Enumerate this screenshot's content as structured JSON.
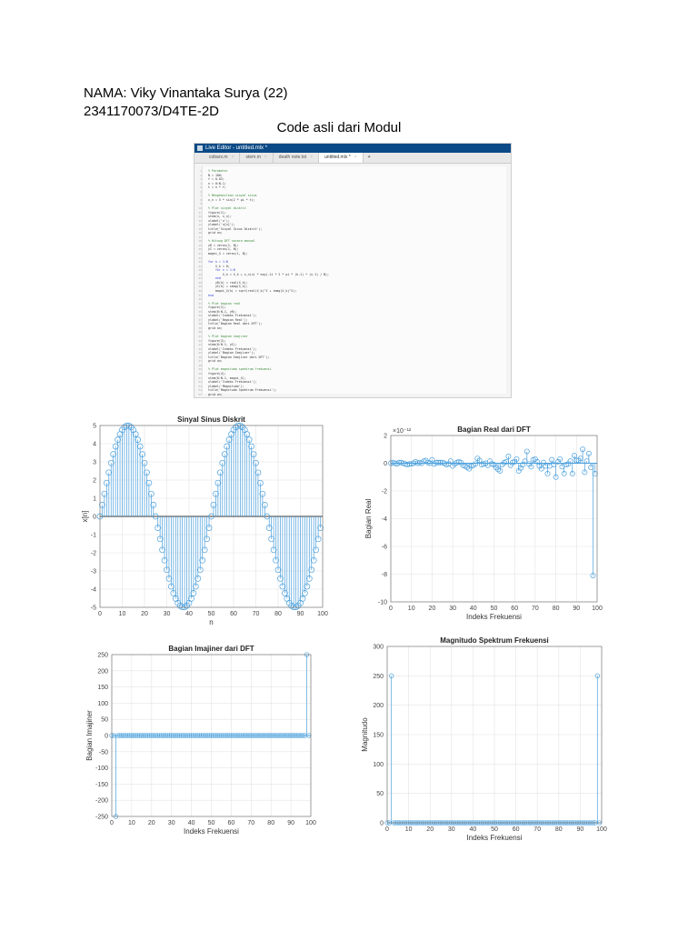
{
  "header": {
    "name_line": "NAMA: Viky Vinantaka Surya (22)",
    "id_line": "2341170073/D4TE-2D",
    "section_title": "Code asli dari Modul"
  },
  "editor": {
    "window_title": "Live Editor - untitled.mlx *",
    "tabs": [
      {
        "label": "cobarx.m",
        "active": false
      },
      {
        "label": "stem.m",
        "active": false
      },
      {
        "label": "death note.txt",
        "active": false
      },
      {
        "label": "untitled.mlx *",
        "active": true
      }
    ],
    "add_tab_label": "+",
    "close_glyph": "×",
    "code_lines": [
      "% Parameter",
      "N = 100;",
      "f = 0.02;",
      "n = 0:N-1;",
      "t = n * f;",
      "",
      "% Menghasilkan sinyal sinus",
      "x_n = 5 * sin(2 * pi * t);",
      "",
      "% Plot sinyal diskrit",
      "figure(1);",
      "stem(n, x_n);",
      "xlabel('n');",
      "ylabel('x[n]');",
      "title('Sinyal Sinus Diskrit');",
      "grid on;",
      "",
      "% Hitung DFT secara manual",
      "yR = zeros(1, N);",
      "yI = zeros(1, N);",
      "magni_X = zeros(1, N);",
      "",
      "for k = 1:N",
      "    X_k = 0;",
      "    for n = 1:N",
      "        X_k = X_k + x_n(n) * exp(-1i * 2 * pi * (k-1) * (n-1) / N);",
      "    end",
      "    yR(k) = real(X_k);",
      "    yI(k) = imag(X_k);",
      "    magni_X(k) = sqrt(real(X_k)^2 + imag(X_k)^2);",
      "end",
      "",
      "% Plot bagian real",
      "figure(2);",
      "stem(0:N-1, yR);",
      "xlabel('Indeks Frekuensi');",
      "ylabel('Bagian Real');",
      "title('Bagian Real dari DFT');",
      "grid on;",
      "",
      "% Plot bagian imajiner",
      "figure(3);",
      "stem(0:N-1, yI);",
      "xlabel('Indeks Frekuensi');",
      "ylabel('Bagian Imajiner');",
      "title('Bagian Imajiner dari DFT');",
      "grid on;",
      "",
      "% Plot magnitudo spektrum frekuensi",
      "figure(4);",
      "stem(0:N-1, magni_X);",
      "xlabel('Indeks Frekuensi');",
      "ylabel('Magnitudo');",
      "title('Magnitudo Spektrum Frekuensi');",
      "grid on;"
    ]
  },
  "colors": {
    "stem": "#4a9fdc",
    "grid": "#e3e3e3",
    "axis": "#666666",
    "baseline": "#333333"
  },
  "chart_data": [
    {
      "type": "stem",
      "title": "Sinyal Sinus Diskrit",
      "xlabel": "n",
      "ylabel": "x[n]",
      "xlim": [
        0,
        100
      ],
      "ylim": [
        -5,
        5
      ],
      "xticks": [
        0,
        10,
        20,
        30,
        40,
        50,
        60,
        70,
        80,
        90,
        100
      ],
      "yticks": [
        -5,
        -4,
        -3,
        -2,
        -1,
        0,
        1,
        2,
        3,
        4,
        5
      ],
      "grid": true,
      "x_start": 0,
      "values": [
        0,
        0.63,
        1.24,
        1.84,
        2.41,
        2.94,
        3.42,
        3.85,
        4.22,
        4.52,
        4.76,
        4.91,
        4.99,
        4.99,
        4.91,
        4.76,
        4.52,
        4.22,
        3.85,
        3.42,
        2.94,
        2.41,
        1.84,
        1.24,
        0.63,
        0,
        -0.63,
        -1.24,
        -1.84,
        -2.41,
        -2.94,
        -3.42,
        -3.85,
        -4.22,
        -4.52,
        -4.76,
        -4.91,
        -4.99,
        -4.99,
        -4.91,
        -4.76,
        -4.52,
        -4.22,
        -3.85,
        -3.42,
        -2.94,
        -2.41,
        -1.84,
        -1.24,
        -0.63,
        0,
        0.63,
        1.24,
        1.84,
        2.41,
        2.94,
        3.42,
        3.85,
        4.22,
        4.52,
        4.76,
        4.91,
        4.99,
        4.99,
        4.91,
        4.76,
        4.52,
        4.22,
        3.85,
        3.42,
        2.94,
        2.41,
        1.84,
        1.24,
        0.63,
        0,
        -0.63,
        -1.24,
        -1.84,
        -2.41,
        -2.94,
        -3.42,
        -3.85,
        -4.22,
        -4.52,
        -4.76,
        -4.91,
        -4.99,
        -4.99,
        -4.91,
        -4.76,
        -4.52,
        -4.22,
        -3.85,
        -3.42,
        -2.94,
        -2.41,
        -1.84,
        -1.24,
        -0.63
      ]
    },
    {
      "type": "stem",
      "title": "Bagian Real dari DFT",
      "xlabel": "Indeks Frekuensi",
      "ylabel": "Bagian Real",
      "exponent_label": "×10⁻¹²",
      "xlim": [
        0,
        100
      ],
      "ylim": [
        -10,
        2
      ],
      "xticks": [
        0,
        10,
        20,
        30,
        40,
        50,
        60,
        70,
        80,
        90,
        100
      ],
      "yticks": [
        -10,
        -8,
        -6,
        -4,
        -2,
        0,
        2
      ],
      "grid": true,
      "x_start": 0,
      "values": [
        0,
        0.05,
        0,
        -0.05,
        0.05,
        0.05,
        0,
        -0.05,
        -0.1,
        -0.05,
        -0.05,
        0,
        0.1,
        0,
        0.05,
        0,
        0.15,
        0.2,
        0.05,
        0,
        0.25,
        -0.05,
        0.05,
        0.05,
        0.05,
        0.05,
        0,
        -0.1,
        -0.05,
        0.15,
        -0.2,
        -0.05,
        0.05,
        0.1,
        0.05,
        -0.15,
        -0.2,
        -0.3,
        -0.4,
        -0.2,
        -0.15,
        -0.05,
        0.35,
        0.2,
        -0.1,
        -0.05,
        0,
        -0.15,
        0.15,
        -0.05,
        -0.1,
        -0.3,
        -0.45,
        -0.55,
        -0.1,
        0.05,
        0.1,
        0.5,
        -0.15,
        0.05,
        0.1,
        0.3,
        -0.55,
        -0.35,
        -0.1,
        0.15,
        0.85,
        -0.05,
        -0.25,
        0.25,
        0.3,
        0.1,
        -0.2,
        -0.4,
        0.05,
        -0.2,
        -0.75,
        -0.2,
        0.25,
        -0.1,
        -1.0,
        0.1,
        0.3,
        -0.25,
        -0.75,
        -0.1,
        -0.05,
        0.15,
        -0.75,
        0.55,
        0.2,
        0.2,
        0.35,
        1.0,
        -0.65,
        0.15,
        0.7,
        -0.3,
        -8.1,
        -0.75
      ]
    },
    {
      "type": "stem",
      "title": "Bagian Imajiner dari DFT",
      "xlabel": "Indeks Frekuensi",
      "ylabel": "Bagian Imajiner",
      "xlim": [
        0,
        100
      ],
      "ylim": [
        -250,
        250
      ],
      "xticks": [
        0,
        10,
        20,
        30,
        40,
        50,
        60,
        70,
        80,
        90,
        100
      ],
      "yticks": [
        -250,
        -200,
        -150,
        -100,
        -50,
        0,
        50,
        100,
        150,
        200,
        250
      ],
      "grid": true,
      "x_start": 0,
      "length": 100,
      "default_value": 0,
      "spikes": [
        {
          "x": 2,
          "y": -250
        },
        {
          "x": 98,
          "y": 250
        }
      ]
    },
    {
      "type": "stem",
      "title": "Magnitudo Spektrum Frekuensi",
      "xlabel": "Indeks Frekuensi",
      "ylabel": "Magnitudo",
      "xlim": [
        0,
        100
      ],
      "ylim": [
        0,
        300
      ],
      "xticks": [
        0,
        10,
        20,
        30,
        40,
        50,
        60,
        70,
        80,
        90,
        100
      ],
      "yticks": [
        0,
        50,
        100,
        150,
        200,
        250,
        300
      ],
      "grid": true,
      "x_start": 0,
      "length": 100,
      "default_value": 0,
      "spikes": [
        {
          "x": 2,
          "y": 250
        },
        {
          "x": 98,
          "y": 250
        }
      ]
    }
  ]
}
